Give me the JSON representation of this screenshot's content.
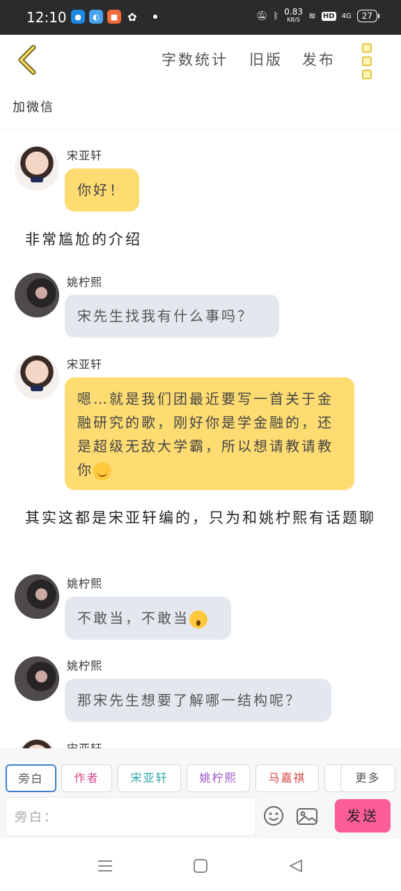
{
  "statusbar": {
    "time": "12:10",
    "net_speed": "0.83",
    "net_unit": "KB/S",
    "hd": "HD",
    "signal": "4G",
    "battery": "27"
  },
  "header": {
    "word_count": "字数统计",
    "old_version": "旧版",
    "publish": "发布"
  },
  "subtitle": "加微信",
  "messages": [
    {
      "type": "bubble",
      "speaker": "宋亚轩",
      "text": "你好！"
    },
    {
      "type": "narration",
      "text": "非常尴尬的介绍"
    },
    {
      "type": "bubble",
      "speaker": "姚柠熙",
      "text": "宋先生找我有什么事吗？"
    },
    {
      "type": "bubble",
      "speaker": "宋亚轩",
      "text": "嗯…就是我们团最近要写一首关于金融研究的歌，刚好你是学金融的，还是超级无敌大学霸，所以想请教请教你"
    },
    {
      "type": "narration",
      "text": "其实这都是宋亚轩编的，只为和姚柠熙有话题聊"
    },
    {
      "type": "bubble",
      "speaker": "姚柠熙",
      "text": "不敢当，不敢当"
    },
    {
      "type": "bubble",
      "speaker": "姚柠熙",
      "text": "那宋先生想要了解哪一结构呢？"
    },
    {
      "type": "bubble",
      "speaker": "宋亚轩",
      "text": ""
    }
  ],
  "characters": {
    "narrator": "旁白",
    "author": "作者",
    "song": "宋亚轩",
    "yao": "姚柠熙",
    "ma": "马嘉祺",
    "more": "更多"
  },
  "colors": {
    "song": "#2aa6a6",
    "yao": "#9b4fc9",
    "ma": "#d64545",
    "author": "#d6478a",
    "accent_yellow": "#fedc72",
    "send_pink": "#fb5d96"
  },
  "input": {
    "placeholder": "旁白：",
    "send_label": "发送"
  }
}
